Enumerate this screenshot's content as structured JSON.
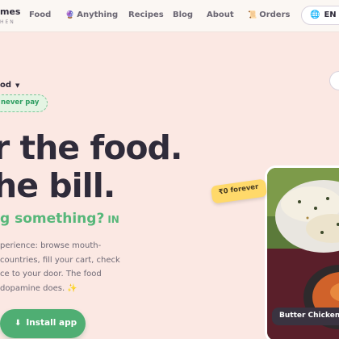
{
  "header": {
    "logo_main": "mes",
    "logo_sub": "HEN",
    "nav": [
      {
        "label": "Food",
        "icon": ""
      },
      {
        "label": "Anything",
        "icon": "globe-icon"
      },
      {
        "label": "Recipes",
        "icon": ""
      },
      {
        "label": "Blog",
        "icon": ""
      },
      {
        "label": "About",
        "icon": ""
      },
      {
        "label": "Orders",
        "icon": "scroll-icon"
      }
    ],
    "language": "EN"
  },
  "hero": {
    "crumb": "od",
    "badge": "never pay",
    "headline_line1": "r the food.",
    "headline_line2": "he bill.",
    "subhead": "g something?",
    "subhead_flag": "IN",
    "paragraph": [
      "perience: browse mouth-",
      "countries, fill your cart, check",
      "ce to your door. The food",
      "dopamine does. ✨"
    ],
    "install_label": "Install app",
    "price_tag": "₹0 forever",
    "photo_caption": "Butter Chicken"
  },
  "colors": {
    "page_bg": "#fbe8e3",
    "accent_green": "#4fae73",
    "tag_yellow": "#ffd96a",
    "text_dark": "#2f2b3a"
  }
}
